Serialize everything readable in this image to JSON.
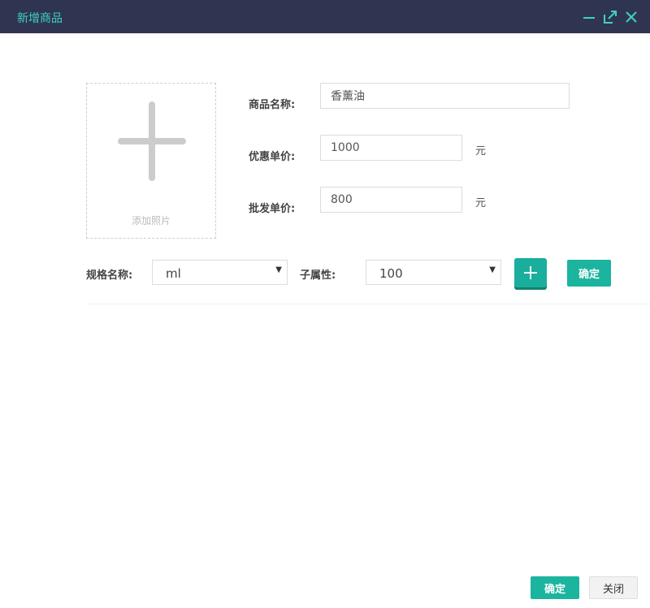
{
  "window": {
    "title": "新增商品",
    "controls": {
      "minimize_icon": "minimize-icon",
      "maximize_icon": "maximize-icon",
      "close_icon": "close-icon"
    }
  },
  "photo": {
    "label": "添加照片",
    "icon": "plus-icon"
  },
  "form": {
    "name_label": "商品名称:",
    "name_value": "香薰油",
    "discount_price_label": "优惠单价:",
    "discount_price_value": "1000",
    "discount_price_unit": "元",
    "wholesale_price_label": "批发单价:",
    "wholesale_price_value": "800",
    "wholesale_price_unit": "元"
  },
  "spec": {
    "name_label": "规格名称:",
    "name_selected": "ml",
    "attr_label": "子属性:",
    "attr_selected": "100",
    "confirm_label": "确定",
    "add_icon": "plus-icon"
  },
  "footer": {
    "confirm_label": "确定",
    "close_label": "关闭"
  },
  "colors": {
    "titlebar": "#2f3551",
    "title_text": "#3fd1c2",
    "accent": "#1bb49e"
  }
}
